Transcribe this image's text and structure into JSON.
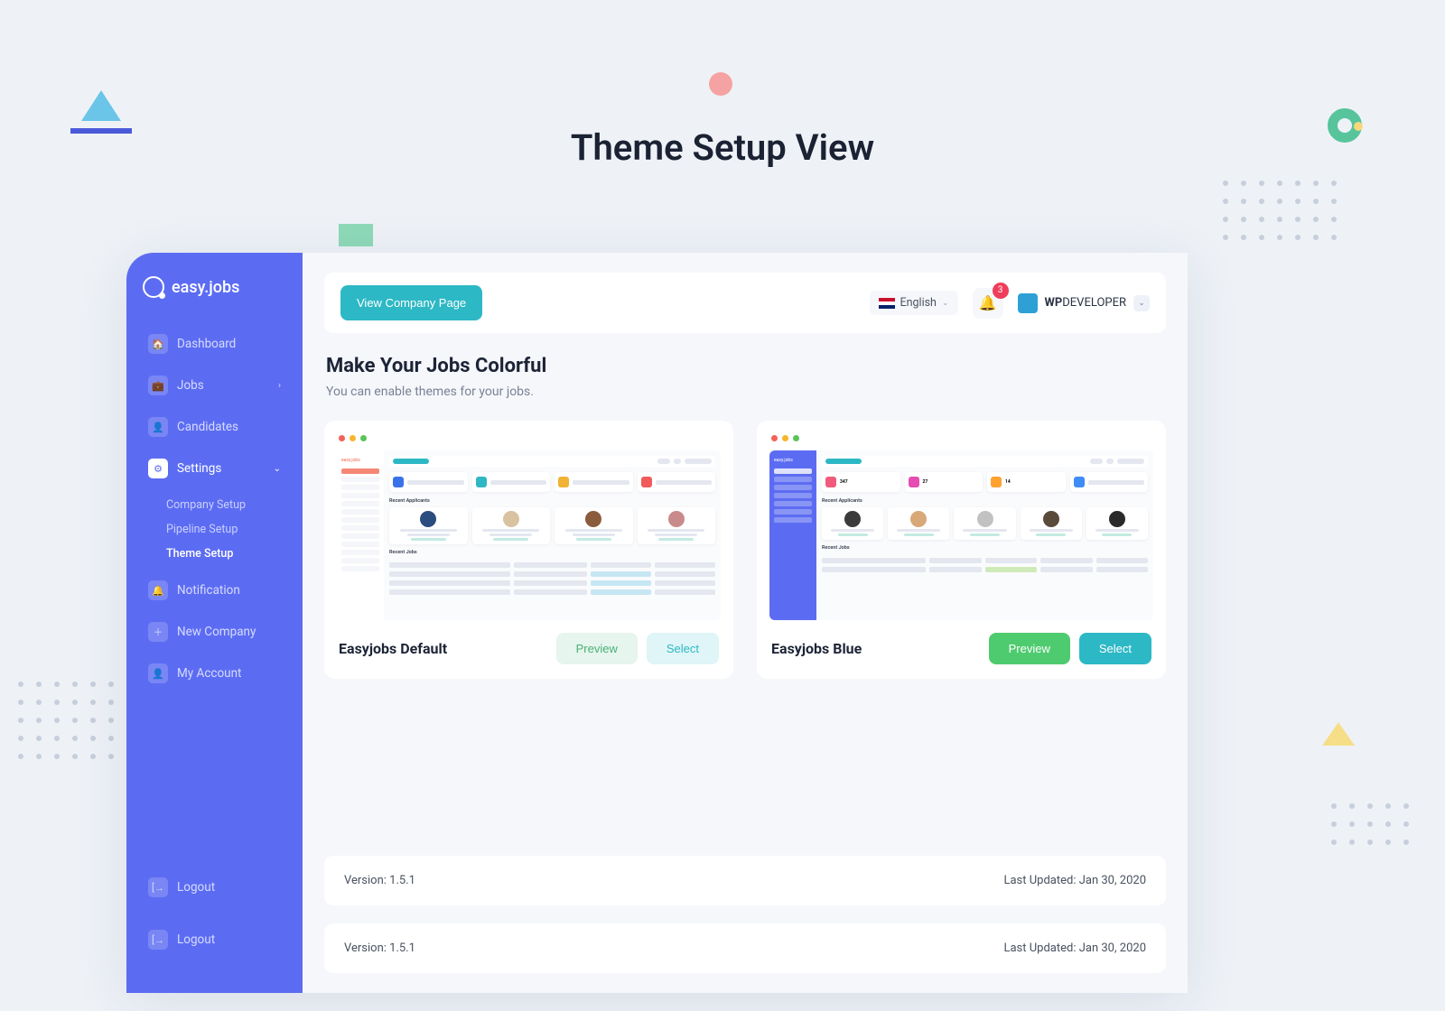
{
  "page_title": "Theme Setup View",
  "brand": {
    "name": "easy.jobs"
  },
  "sidebar": {
    "items": [
      {
        "label": "Dashboard",
        "icon": "home-icon"
      },
      {
        "label": "Jobs",
        "icon": "briefcase-icon",
        "has_chevron": true
      },
      {
        "label": "Candidates",
        "icon": "user-icon"
      },
      {
        "label": "Settings",
        "icon": "gear-icon",
        "active": true,
        "expanded": true,
        "children": [
          {
            "label": "Company Setup"
          },
          {
            "label": "Pipeline Setup"
          },
          {
            "label": "Theme Setup",
            "current": true
          }
        ]
      },
      {
        "label": "Notification",
        "icon": "bell-icon"
      },
      {
        "label": "New Company",
        "icon": "plus-icon"
      },
      {
        "label": "My Account",
        "icon": "person-icon"
      }
    ],
    "footer": [
      {
        "label": "Logout",
        "icon": "logout-icon"
      },
      {
        "label": "Logout",
        "icon": "logout-icon"
      }
    ]
  },
  "topbar": {
    "view_company_page": "View Company Page",
    "language": "English",
    "notification_count": "3",
    "org_name": "WPDEVELOPER"
  },
  "heading": {
    "title": "Make Your Jobs Colorful",
    "subtitle": "You can enable themes for your jobs."
  },
  "themes": [
    {
      "name": "Easyjobs Default",
      "preview_label": "Preview",
      "select_label": "Select"
    },
    {
      "name": "Easyjobs Blue",
      "preview_label": "Preview",
      "select_label": "Select"
    }
  ],
  "footer_rows": [
    {
      "version_label": "Version: 1.5.1",
      "updated_label": "Last Updated: Jan 30, 2020"
    },
    {
      "version_label": "Version: 1.5.1",
      "updated_label": "Last Updated: Jan 30, 2020"
    }
  ],
  "mini_default": {
    "brand": "easy.jobs",
    "recent_applicants": "Recent Applicants",
    "recent_jobs": "Recent Jobs"
  },
  "mini_blue": {
    "brand": "easy.jobs",
    "stats": [
      "347",
      "27",
      "14"
    ],
    "recent_applicants": "Recent Applicants",
    "recent_jobs": "Recent Jobs"
  },
  "colors": {
    "sidebar": "#5c6cf2",
    "accent_teal": "#2db8c5",
    "accent_green": "#4fcb6f"
  }
}
